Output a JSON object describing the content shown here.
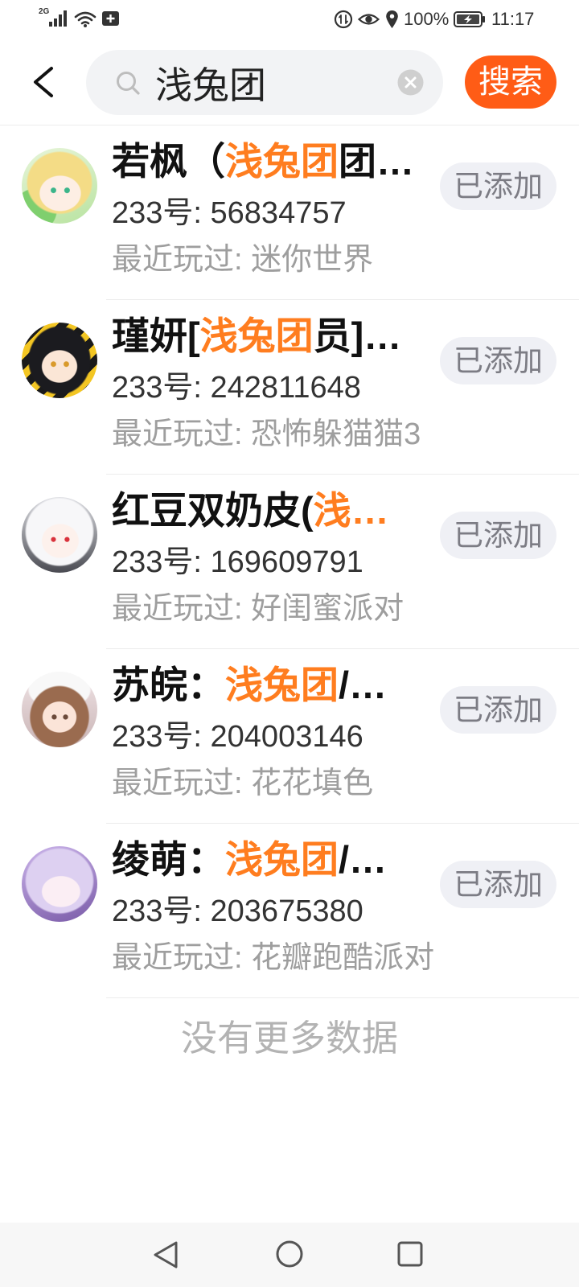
{
  "status_bar": {
    "network_type": "2G",
    "battery_level": "100%",
    "time": "11:17",
    "left_icons": [
      "signal-icon",
      "wifi-icon",
      "notification-plus-icon"
    ],
    "right_icons": [
      "data-saver-icon",
      "eye-icon",
      "location-icon",
      "battery-charging-icon"
    ]
  },
  "header": {
    "back_icon": "chevron-left-icon",
    "search": {
      "icon": "search-icon",
      "value": "浅兔团",
      "clear_icon": "clear-icon"
    },
    "search_button_label": "搜索"
  },
  "colors": {
    "accent": "#ff5c16",
    "highlight": "#ff7d1f",
    "added_bg": "#eff0f5",
    "added_text": "#7c7c84",
    "muted_text": "#9e9e9e"
  },
  "results": [
    {
      "name": {
        "before": "若枫（",
        "match": "浅兔团",
        "after": "团…"
      },
      "id_label": "233号:",
      "id": "56834757",
      "played_label": "最近玩过:",
      "game": "迷你世界",
      "action_label": "已添加"
    },
    {
      "name": {
        "before": "瑾妍[",
        "match": "浅兔团",
        "after": "员]…"
      },
      "id_label": "233号:",
      "id": "242811648",
      "played_label": "最近玩过:",
      "game": "恐怖躲猫猫3",
      "action_label": "已添加"
    },
    {
      "name": {
        "before": "红豆双奶皮(",
        "match": "浅…"
      },
      "id_label": "233号:",
      "id": "169609791",
      "played_label": "最近玩过:",
      "game": "好闺蜜派对",
      "action_label": "已添加"
    },
    {
      "name": {
        "before": "苏皖：",
        "match": "浅兔团",
        "after": "/…"
      },
      "id_label": "233号:",
      "id": "204003146",
      "played_label": "最近玩过:",
      "game": "花花填色",
      "action_label": "已添加"
    },
    {
      "name": {
        "before": "绫萌：",
        "match": "浅兔团",
        "after": "/…"
      },
      "id_label": "233号:",
      "id": "203675380",
      "played_label": "最近玩过:",
      "game": "花瓣跑酷派对",
      "action_label": "已添加"
    }
  ],
  "footer": {
    "end_text": "没有更多数据"
  },
  "nav_bar": {
    "icons": [
      "back-triangle-icon",
      "home-circle-icon",
      "recents-square-icon"
    ]
  }
}
